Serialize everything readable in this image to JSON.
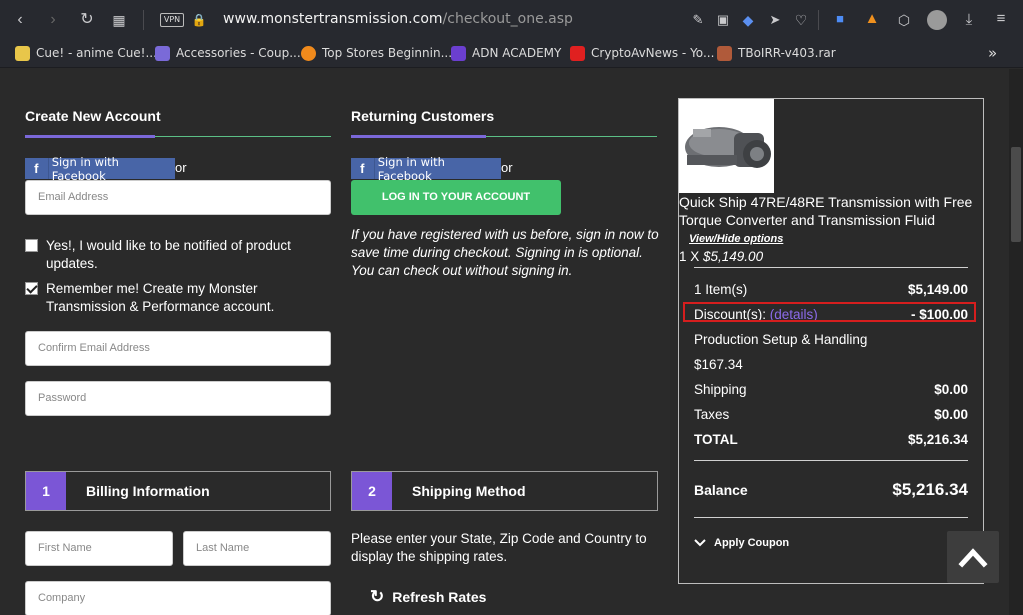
{
  "browser": {
    "vpn_label": "VPN",
    "url_host": "www.monstertransmission.com",
    "url_path": "/checkout_one.asp",
    "bookmarks": [
      {
        "label": "Cue! - anime Cue!...",
        "color": "#e8c64a"
      },
      {
        "label": "Accessories - Coup...",
        "color": "#7a6ad8"
      },
      {
        "label": "Top Stores Beginnin...",
        "color": "#f08a1c"
      },
      {
        "label": "ADN ACADEMY",
        "color": "#6b3fd0"
      },
      {
        "label": "CryptoAvNews - Yo...",
        "color": "#e02020"
      },
      {
        "label": "TBoIRR-v403.rar",
        "color": "#b05a3a"
      }
    ],
    "overflow_label": "»"
  },
  "create_account": {
    "title": "Create New Account",
    "facebook_label": "Sign in with Facebook",
    "or_label": "or",
    "email_placeholder": "Email Address",
    "notify_label": "Yes!, I would like to be notified of product updates.",
    "remember_label": "Remember me! Create my Monster Transmission & Performance account.",
    "confirm_email_placeholder": "Confirm Email Address",
    "password_placeholder": "Password"
  },
  "returning": {
    "title": "Returning Customers",
    "facebook_label": "Sign in with Facebook",
    "or_label": "or",
    "login_label": "LOG IN TO YOUR ACCOUNT",
    "note": "If you have registered with us before, sign in now to save time during checkout. Signing in is optional. You can check out without signing in."
  },
  "billing": {
    "step_number": "1",
    "title": "Billing Information",
    "first_name_placeholder": "First Name",
    "last_name_placeholder": "Last Name",
    "company_placeholder": "Company"
  },
  "shipping": {
    "step_number": "2",
    "title": "Shipping Method",
    "note": "Please enter your State, Zip Code and Country to display the shipping rates.",
    "refresh_label": "Refresh Rates"
  },
  "summary": {
    "product_title": "Quick Ship 47RE/48RE Transmission with Free Torque Converter and Transmission Fluid",
    "view_hide": "View/Hide options",
    "qty_prefix": "1 X ",
    "qty_price": "$5,149.00",
    "items_label": "1 Item(s)",
    "items_value": "$5,149.00",
    "discount_label": "Discount(s):",
    "discount_link": "(details)",
    "discount_value": "- $100.00",
    "setup_label": "Production Setup & Handling",
    "setup_value": "$167.34",
    "shipping_label": "Shipping",
    "shipping_value": "$0.00",
    "taxes_label": "Taxes",
    "taxes_value": "$0.00",
    "total_label": "TOTAL",
    "total_value": "$5,216.34",
    "balance_label": "Balance",
    "balance_value": "$5,216.34",
    "coupon_label": "Apply Coupon"
  }
}
